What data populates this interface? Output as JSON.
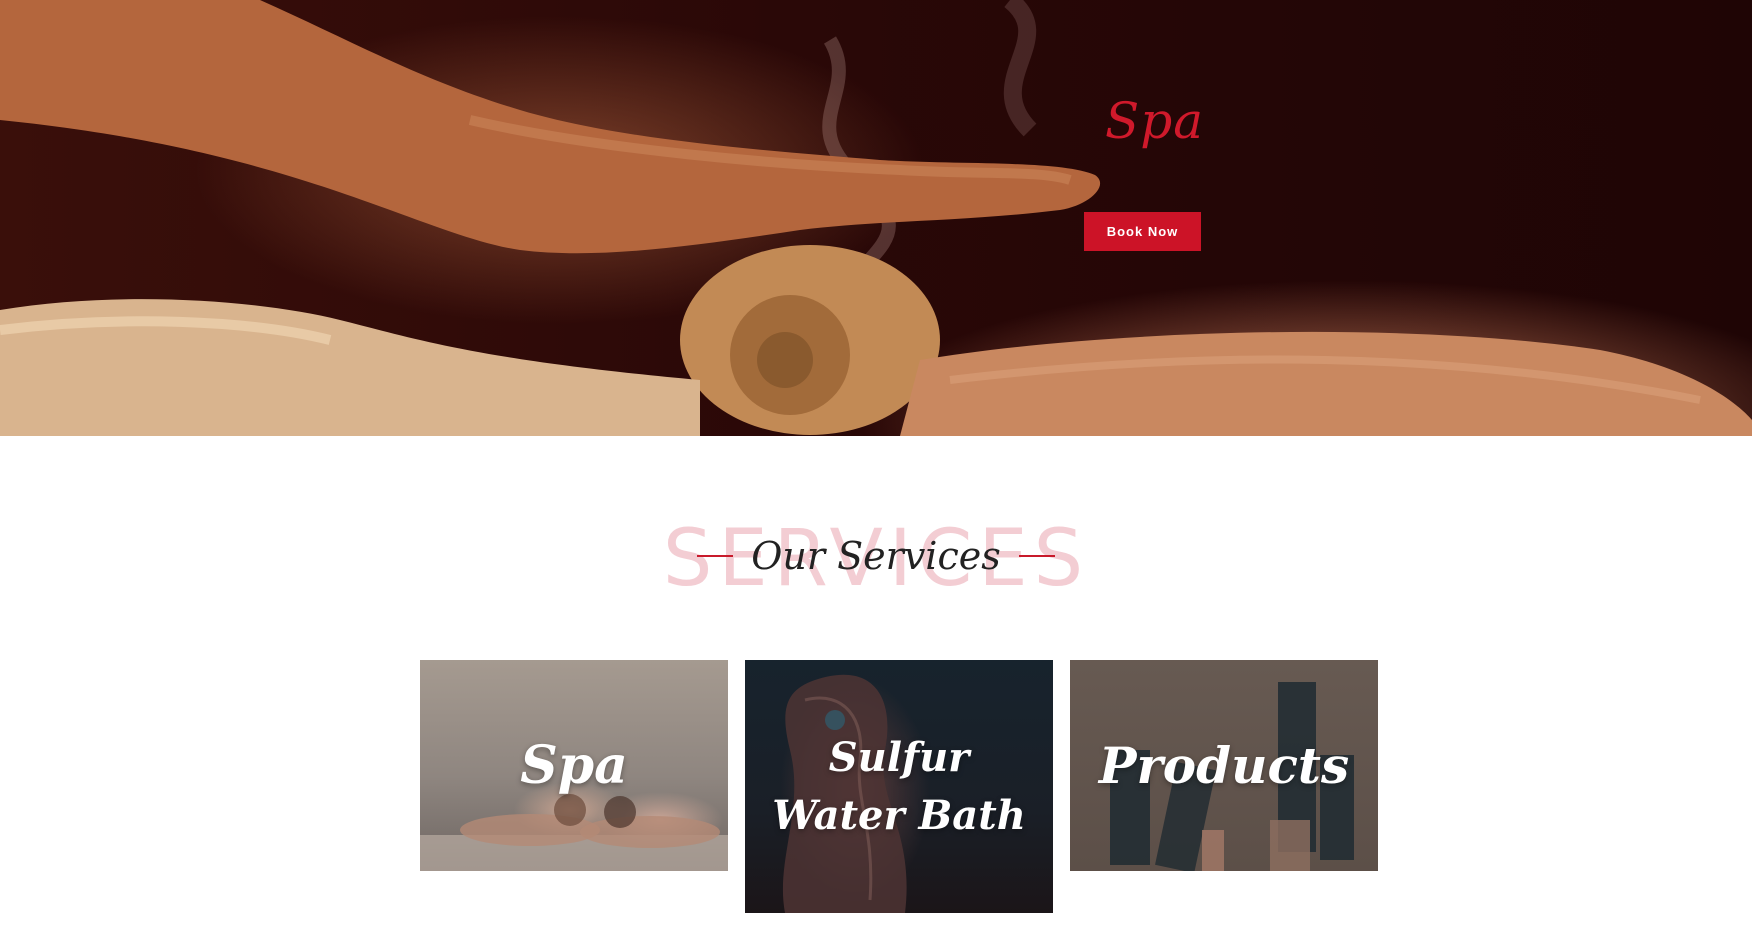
{
  "hero": {
    "title": "Spa",
    "button_label": "Book Now"
  },
  "services": {
    "watermark": "SERVICES",
    "title": "Our Services"
  },
  "cards": [
    {
      "label": "Spa"
    },
    {
      "label_line1": "Sulfur",
      "label_line2": "Water Bath"
    },
    {
      "label": "Products"
    }
  ],
  "colors": {
    "accent": "#cc1327",
    "watermark": "#f3cdd3",
    "hero_dark": "#240606"
  },
  "icons": {
    "hero_image": "massage-hand-towel-image"
  }
}
